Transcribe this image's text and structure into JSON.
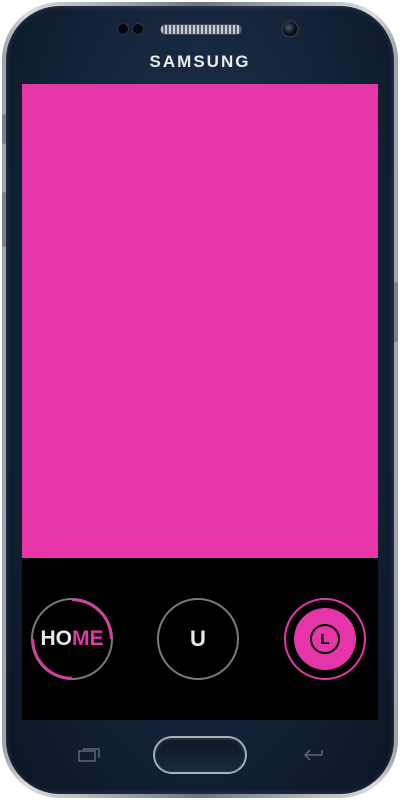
{
  "device": {
    "brand": "SAMSUNG"
  },
  "app": {
    "content_color": "#e535a7",
    "accent_color": "#e635a8"
  },
  "nav": {
    "home": {
      "label_part1": "HO",
      "label_part2": "ME",
      "icon": "home-progress-ring"
    },
    "u": {
      "label": "U"
    },
    "l": {
      "label": "L",
      "state": "selected"
    }
  },
  "hardware_keys": {
    "recent": {
      "icon": "recent-apps-icon"
    },
    "home": {
      "icon": "home-key"
    },
    "back": {
      "icon": "back-arrow-icon"
    }
  }
}
